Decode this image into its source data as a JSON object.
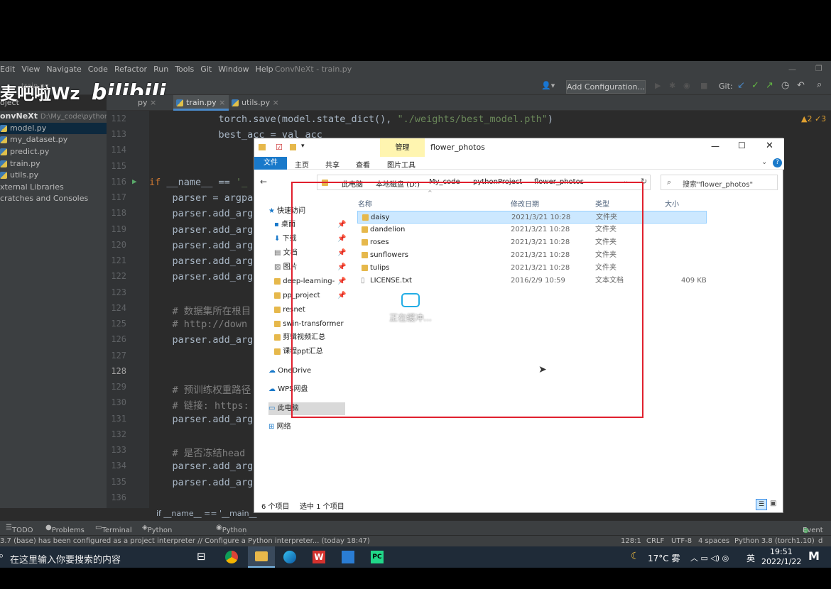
{
  "ide": {
    "menu": [
      "Edit",
      "View",
      "Navigate",
      "Code",
      "Refactor",
      "Run",
      "Tools",
      "Git",
      "Window",
      "Help"
    ],
    "window_title": "ConvNeXt - train.py",
    "run_config": "Add Configuration...",
    "git_label": "Git:",
    "tabs": [
      "train.py",
      "utils.py"
    ],
    "partial_tab": "py",
    "project_label": "oject",
    "root_label": "onvNeXt",
    "root_path": "D:\\My_code\\pythonP",
    "files": [
      "model.py",
      "my_dataset.py",
      "predict.py",
      "train.py",
      "utils.py",
      "xternal Libraries",
      "cratches and Consoles"
    ],
    "inspection": "▲2 ✓3",
    "line_numbers": [
      "112",
      "113",
      "114",
      "115",
      "116",
      "117",
      "118",
      "119",
      "120",
      "121",
      "122",
      "123",
      "124",
      "125",
      "126",
      "127",
      "128",
      "129",
      "130",
      "131",
      "132",
      "133",
      "134",
      "135",
      "136"
    ],
    "code": {
      "l112a": "            torch.save(model.state_dict(), ",
      "l112b": "\"./weights/best_model.pth\"",
      "l112c": ")",
      "l113": "            best_acc = val_acc",
      "l116a": "if",
      "l116b": " __name__ == ",
      "l116c": "'_",
      "l117": "    parser = argpa",
      "l118": "    parser.add_arg",
      "l119": "    parser.add_arg",
      "l120": "    parser.add_arg",
      "l121": "    parser.add_arg",
      "l122": "    parser.add_arg",
      "l124": "    # 数据集所在根目",
      "l125": "    # http://down",
      "l126": "    parser.add_arg",
      "l129": "    # 预训练权重路径",
      "l130": "    # 链接: https:",
      "l131": "    parser.add_arg",
      "l133": "    # 是否冻结head",
      "l134": "    parser.add_arg",
      "l135": "    parser.add_arg"
    },
    "breadcrumb": "if __name__ == '__main__'",
    "toolwindows": [
      "TODO",
      "Problems",
      "Terminal",
      "Python Packages",
      "Python Console",
      "Event"
    ],
    "status_msg": "3.7 (base) has been configured as a project interpreter // Configure a Python interpreter... (today 18:47)",
    "status_right": [
      "128:1",
      "CRLF",
      "UTF-8",
      "4 spaces",
      "Python 3.8 (torch1.10)"
    ],
    "status_tail": "d"
  },
  "watermark": {
    "text": "麦吧啦Wz",
    "logo": "bilibili",
    "ghost": "train.py"
  },
  "explorer": {
    "ribbon_context_group": "管理",
    "title": "flower_photos",
    "ribbon_tabs": [
      "文件",
      "主页",
      "共享",
      "查看",
      "图片工具"
    ],
    "breadcrumb": [
      "此电脑",
      "本地磁盘 (D:)",
      "My_code",
      "pythonProject",
      "flower_photos"
    ],
    "search_placeholder": "搜索\"flower_photos\"",
    "columns": [
      "名称",
      "修改日期",
      "类型",
      "大小"
    ],
    "nav": {
      "quick_access": "快速访问",
      "items": [
        "桌面",
        "下载",
        "文档",
        "图片",
        "deep-learning-",
        "pp_project",
        "resnet",
        "swin-transformer",
        "剪辑视频汇总",
        "课程ppt汇总"
      ],
      "onedrive": "OneDrive",
      "wps": "WPS网盘",
      "thispc": "此电脑",
      "network": "网络"
    },
    "files": [
      {
        "name": "daisy",
        "date": "2021/3/21 10:28",
        "type": "文件夹",
        "size": ""
      },
      {
        "name": "dandelion",
        "date": "2021/3/21 10:28",
        "type": "文件夹",
        "size": ""
      },
      {
        "name": "roses",
        "date": "2021/3/21 10:28",
        "type": "文件夹",
        "size": ""
      },
      {
        "name": "sunflowers",
        "date": "2021/3/21 10:28",
        "type": "文件夹",
        "size": ""
      },
      {
        "name": "tulips",
        "date": "2021/3/21 10:28",
        "type": "文件夹",
        "size": ""
      },
      {
        "name": "LICENSE.txt",
        "date": "2016/2/9 10:59",
        "type": "文本文档",
        "size": "409 KB"
      }
    ],
    "buffering": "正在缓冲...",
    "count": "6 个项目",
    "selected": "选中 1 个项目"
  },
  "taskbar": {
    "search_placeholder": "在这里输入你要搜索的内容",
    "weather": "17°C 雾",
    "ime": "英",
    "time": "19:51",
    "date": "2022/1/22"
  },
  "colors": {
    "selection": "#cce8ff",
    "annotation_box": "#e0202e",
    "ide_bg": "#2b2b2b"
  }
}
